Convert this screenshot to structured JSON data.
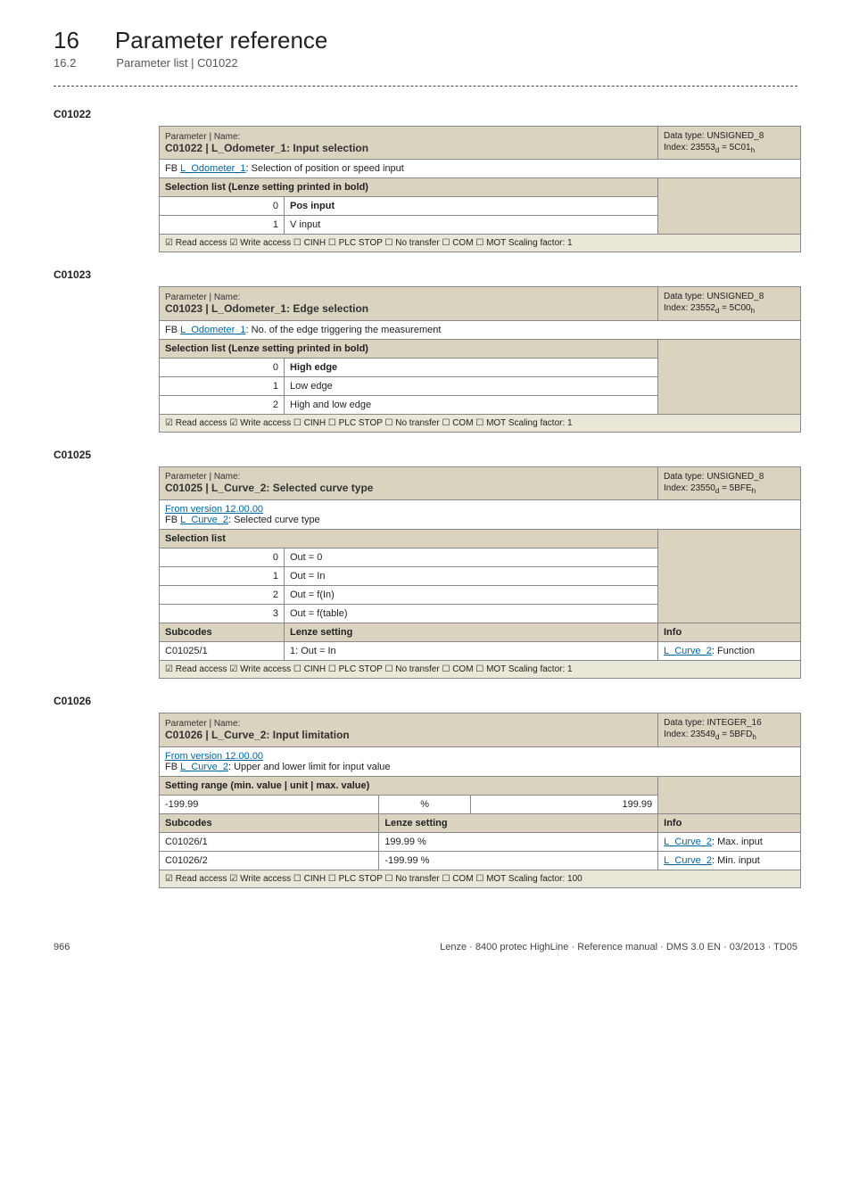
{
  "chapter": {
    "num": "16",
    "title": "Parameter reference"
  },
  "subsection": {
    "num": "16.2",
    "title": "Parameter list | C01022"
  },
  "labels": {
    "param_name": "Parameter | Name:",
    "selection_list_bold": "Selection list (Lenze setting printed in bold)",
    "selection_list": "Selection list",
    "setting_range": "Setting range (min. value | unit | max. value)",
    "subcodes": "Subcodes",
    "lenze_setting": "Lenze setting",
    "info": "Info"
  },
  "c01022": {
    "code": "C01022",
    "header": "C01022 | L_Odometer_1: Input selection",
    "datatype": "Data type: UNSIGNED_8",
    "index": "Index: 23553",
    "index_suffix_d": "d",
    "index_eq": " = 5C01",
    "index_suffix_h": "h",
    "desc_pre": "FB ",
    "desc_link": "L_Odometer_1",
    "desc_post": ": Selection of position or speed input",
    "rows": [
      {
        "idx": "0",
        "text": "Pos input",
        "bold": true
      },
      {
        "idx": "1",
        "text": "V input",
        "bold": false
      }
    ],
    "footer": "☑ Read access   ☑ Write access   ☐ CINH   ☐ PLC STOP   ☐ No transfer   ☐ COM   ☐ MOT    Scaling factor: 1"
  },
  "c01023": {
    "code": "C01023",
    "header": "C01023 | L_Odometer_1: Edge selection",
    "datatype": "Data type: UNSIGNED_8",
    "index": "Index: 23552",
    "index_suffix_d": "d",
    "index_eq": " = 5C00",
    "index_suffix_h": "h",
    "desc_pre": "FB ",
    "desc_link": "L_Odometer_1",
    "desc_post": ": No. of the edge triggering the measurement",
    "rows": [
      {
        "idx": "0",
        "text": "High edge",
        "bold": true
      },
      {
        "idx": "1",
        "text": "Low edge",
        "bold": false
      },
      {
        "idx": "2",
        "text": "High and low edge",
        "bold": false
      }
    ],
    "footer": "☑ Read access   ☑ Write access   ☐ CINH   ☐ PLC STOP   ☐ No transfer   ☐ COM   ☐ MOT    Scaling factor: 1"
  },
  "c01025": {
    "code": "C01025",
    "header": "C01025 | L_Curve_2: Selected curve type",
    "datatype": "Data type: UNSIGNED_8",
    "index": "Index: 23550",
    "index_suffix_d": "d",
    "index_eq": " = 5BFE",
    "index_suffix_h": "h",
    "note": "From version 12.00.00",
    "desc_pre": "FB ",
    "desc_link": "L_Curve_2",
    "desc_post": ": Selected curve type",
    "rows": [
      {
        "idx": "0",
        "text": "Out = 0"
      },
      {
        "idx": "1",
        "text": "Out = In"
      },
      {
        "idx": "2",
        "text": "Out = f(In)"
      },
      {
        "idx": "3",
        "text": "Out = f(table)"
      }
    ],
    "subrow": {
      "code": "C01025/1",
      "setting": "1: Out = In",
      "info_link": "L_Curve_2",
      "info_post": ": Function"
    },
    "footer": "☑ Read access   ☑ Write access   ☐ CINH   ☐ PLC STOP   ☐ No transfer   ☐ COM   ☐ MOT    Scaling factor: 1"
  },
  "c01026": {
    "code": "C01026",
    "header": "C01026 | L_Curve_2: Input limitation",
    "datatype": "Data type: INTEGER_16",
    "index": "Index: 23549",
    "index_suffix_d": "d",
    "index_eq": " = 5BFD",
    "index_suffix_h": "h",
    "note": "From version 12.00.00",
    "desc_pre": "FB ",
    "desc_link": "L_Curve_2",
    "desc_post": ": Upper and lower limit for input value",
    "range": {
      "min": "-199.99",
      "unit": "%",
      "max": "199.99"
    },
    "subrows": [
      {
        "code": "C01026/1",
        "setting": "199.99 %",
        "info_link": "L_Curve_2",
        "info_post": ": Max. input"
      },
      {
        "code": "C01026/2",
        "setting": "-199.99 %",
        "info_link": "L_Curve_2",
        "info_post": ": Min. input"
      }
    ],
    "footer": "☑ Read access   ☑ Write access   ☐ CINH   ☐ PLC STOP   ☐ No transfer   ☐ COM   ☐ MOT    Scaling factor: 100"
  },
  "footer": {
    "page": "966",
    "doc": "Lenze · 8400 protec HighLine · Reference manual · DMS 3.0 EN · 03/2013 · TD05"
  }
}
